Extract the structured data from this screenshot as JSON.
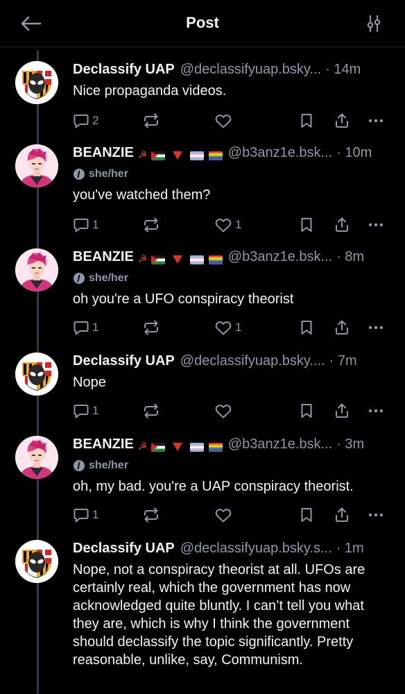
{
  "header": {
    "title": "Post"
  },
  "posts": [
    {
      "name": "Declassify UAP",
      "handle": "@declassifyuap.bsky...",
      "time": "· 14m",
      "text": "Nice propaganda videos.",
      "replies": "2",
      "likes": "",
      "avatar": "maryland-alien-avatar"
    },
    {
      "name": "BEANZIE",
      "handle": "@b3anz1e.bsk...",
      "time": "· 10m",
      "pronouns": "she/her",
      "text": "you've watched them?",
      "replies": "1",
      "likes": "1",
      "avatar": "pink-hair-avatar"
    },
    {
      "name": "BEANZIE",
      "handle": "@b3anz1e.bsk...",
      "time": "· 8m",
      "pronouns": "she/her",
      "text": "oh you're a UFO conspiracy theorist",
      "replies": "1",
      "likes": "1",
      "avatar": "pink-hair-avatar"
    },
    {
      "name": "Declassify UAP",
      "handle": "@declassifyuap.bsky....",
      "time": "· 7m",
      "text": "Nope",
      "replies": "1",
      "likes": "",
      "avatar": "maryland-alien-avatar"
    },
    {
      "name": "BEANZIE",
      "handle": "@b3anz1e.bsk...",
      "time": "· 3m",
      "pronouns": "she/her",
      "text": "oh, my bad. you're a UAP conspiracy theorist.",
      "replies": "1",
      "likes": "",
      "avatar": "pink-hair-avatar"
    },
    {
      "name": "Declassify UAP",
      "handle": "@declassifyuap.bsky.s...",
      "time": "· 1m",
      "text": "Nope, not a conspiracy theorist at all. UFOs are certainly real, which the government has now acknowledged quite bluntly. I can’t tell you what they are, which is why I think the government should declassify the topic significantly. Pretty reasonable, unlike, say, Communism.",
      "avatar": "maryland-alien-avatar"
    }
  ],
  "colors": {
    "background": "#000000",
    "text": "#f1f3f5",
    "muted": "#8b98a9",
    "thread_line": "#2e3b4a"
  },
  "icons": [
    "back-arrow-icon",
    "filter-sliders-icon",
    "reply-icon",
    "repost-icon",
    "like-icon",
    "bookmark-icon",
    "share-icon",
    "more-icon",
    "pronoun-badge-icon"
  ]
}
